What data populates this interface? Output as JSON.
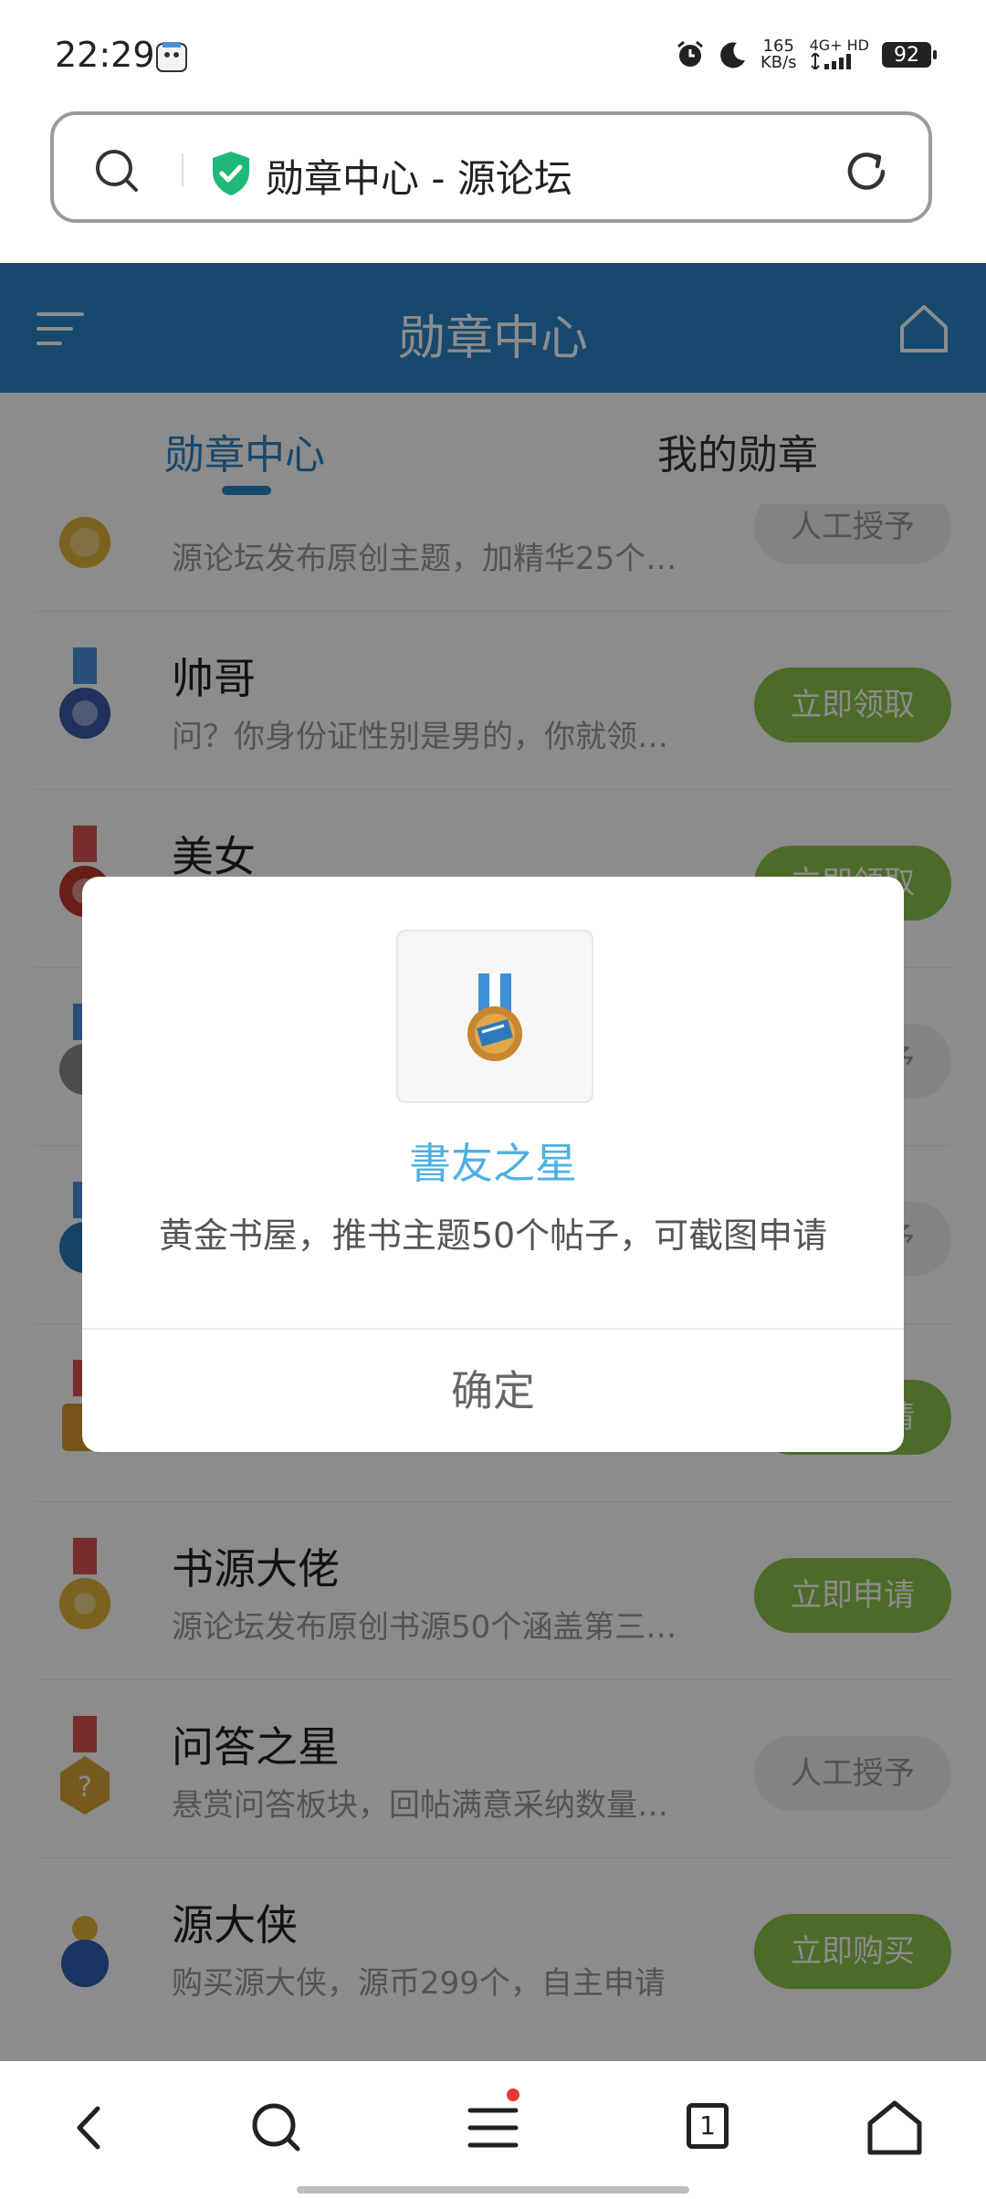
{
  "status_bar": {
    "time": "22:29",
    "speed_value": "165",
    "speed_unit": "KB/s",
    "network": "4G+ HD",
    "battery": "92"
  },
  "address_bar": {
    "title": "勋章中心 - 源论坛"
  },
  "header": {
    "title": "勋章中心"
  },
  "tabs": [
    {
      "label": "勋章中心",
      "active": true
    },
    {
      "label": "我的勋章",
      "active": false
    }
  ],
  "medals": [
    {
      "title": "",
      "desc": "源论坛发布原创主题，加精华25个…",
      "button": "人工授予",
      "style": "grey",
      "medal_color": "#e0b43a"
    },
    {
      "title": "帅哥",
      "desc": "问？你身份证性别是男的，你就领…",
      "button": "立即领取",
      "style": "green",
      "medal_color": "#3b5aa8"
    },
    {
      "title": "美女",
      "desc": "",
      "button": "立即领取",
      "style": "green",
      "medal_color": "#c0392b"
    },
    {
      "title": "",
      "desc": "",
      "button": "人工授予",
      "style": "grey",
      "medal_color": "#8c8c8c"
    },
    {
      "title": "",
      "desc": "",
      "button": "人工授予",
      "style": "grey",
      "medal_color": "#2e7ab8"
    },
    {
      "title": "",
      "desc": "",
      "button": "立即申请",
      "style": "green",
      "medal_color": "#d79a2b"
    },
    {
      "title": "书源大佬",
      "desc": "源论坛发布原创书源50个涵盖第三…",
      "button": "立即申请",
      "style": "green",
      "medal_color": "#e0b43a"
    },
    {
      "title": "问答之星",
      "desc": "悬赏问答板块，回帖满意采纳数量…",
      "button": "人工授予",
      "style": "grey",
      "medal_color": "#d8a33a"
    },
    {
      "title": "源大侠",
      "desc": "购买源大侠，源币299个，自主申请",
      "button": "立即购买",
      "style": "green",
      "medal_color": "#2f5fb0"
    }
  ],
  "dialog": {
    "title": "書友之星",
    "desc": "黄金书屋，推书主题50个帖子，可截图申请",
    "ok_label": "确定"
  },
  "bottom_nav": {
    "tab_count": "1"
  },
  "colors": {
    "primary": "#2a84c6",
    "green_button": "#8bc34a",
    "dialog_title": "#4fb0e0"
  }
}
